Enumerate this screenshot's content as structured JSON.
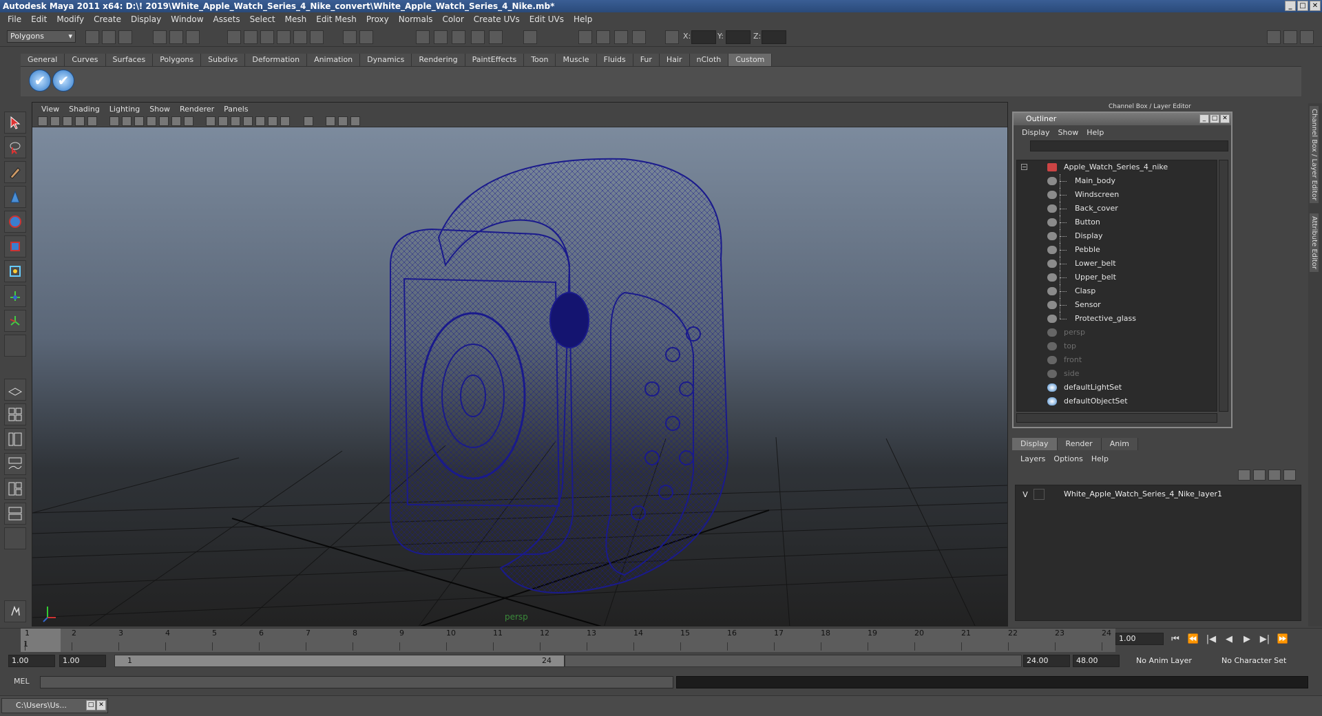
{
  "window": {
    "title": "Autodesk Maya 2011 x64: D:\\! 2019\\White_Apple_Watch_Series_4_Nike_convert\\White_Apple_Watch_Series_4_Nike.mb*",
    "minimize": "_",
    "maximize": "□",
    "close": "✕"
  },
  "menubar": [
    "File",
    "Edit",
    "Modify",
    "Create",
    "Display",
    "Window",
    "Assets",
    "Select",
    "Mesh",
    "Edit Mesh",
    "Proxy",
    "Normals",
    "Color",
    "Create UVs",
    "Edit UVs",
    "Help"
  ],
  "toolbar": {
    "mode": "Polygons",
    "x_label": "X:",
    "y_label": "Y:",
    "z_label": "Z:"
  },
  "shelf": {
    "tabs": [
      "General",
      "Curves",
      "Surfaces",
      "Polygons",
      "Subdivs",
      "Deformation",
      "Animation",
      "Dynamics",
      "Rendering",
      "PaintEffects",
      "Toon",
      "Muscle",
      "Fluids",
      "Fur",
      "Hair",
      "nCloth",
      "Custom"
    ],
    "active_tab": "Custom",
    "check_glyph": "✔"
  },
  "viewport": {
    "menu": [
      "View",
      "Shading",
      "Lighting",
      "Show",
      "Renderer",
      "Panels"
    ],
    "camera_label": "persp",
    "wire_color": "#1a1a8c"
  },
  "channel_box": {
    "title": "Channel Box / Layer Editor",
    "side_tabs": [
      "Channel Box / Layer Editor",
      "Attribute Editor"
    ]
  },
  "outliner": {
    "title": "Outliner",
    "menu": [
      "Display",
      "Show",
      "Help"
    ],
    "root": "Apple_Watch_Series_4_nike",
    "children": [
      "Main_body",
      "Windscreen",
      "Back_cover",
      "Button",
      "Display",
      "Pebble",
      "Lower_belt",
      "Upper_belt",
      "Clasp",
      "Sensor",
      "Protective_glass"
    ],
    "cameras": [
      "persp",
      "top",
      "front",
      "side"
    ],
    "sets": [
      "defaultLightSet",
      "defaultObjectSet"
    ]
  },
  "layer_editor": {
    "tabs": [
      "Display",
      "Render",
      "Anim"
    ],
    "active_tab": "Display",
    "menu": [
      "Layers",
      "Options",
      "Help"
    ],
    "layer_visible": "V",
    "layer_name": "White_Apple_Watch_Series_4_Nike_layer1"
  },
  "timeline": {
    "ticks": [
      "1",
      "2",
      "3",
      "4",
      "5",
      "6",
      "7",
      "8",
      "9",
      "10",
      "11",
      "12",
      "13",
      "14",
      "15",
      "16",
      "17",
      "18",
      "19",
      "20",
      "21",
      "22",
      "23",
      "24"
    ],
    "current_frame_label": "1",
    "current_frame": "1.00",
    "playback": [
      "⏮",
      "⏪",
      "|◀",
      "◀",
      "▶",
      "▶|",
      "⏩"
    ]
  },
  "range": {
    "start": "1.00",
    "start2": "1.00",
    "slider_start": "1",
    "slider_end": "24",
    "end": "24.00",
    "end2": "48.00",
    "anim_layer": "No Anim Layer",
    "character_set": "No Character Set"
  },
  "cmdline": {
    "label": "MEL"
  },
  "taskbar": {
    "item": "C:\\Users\\Us..."
  }
}
